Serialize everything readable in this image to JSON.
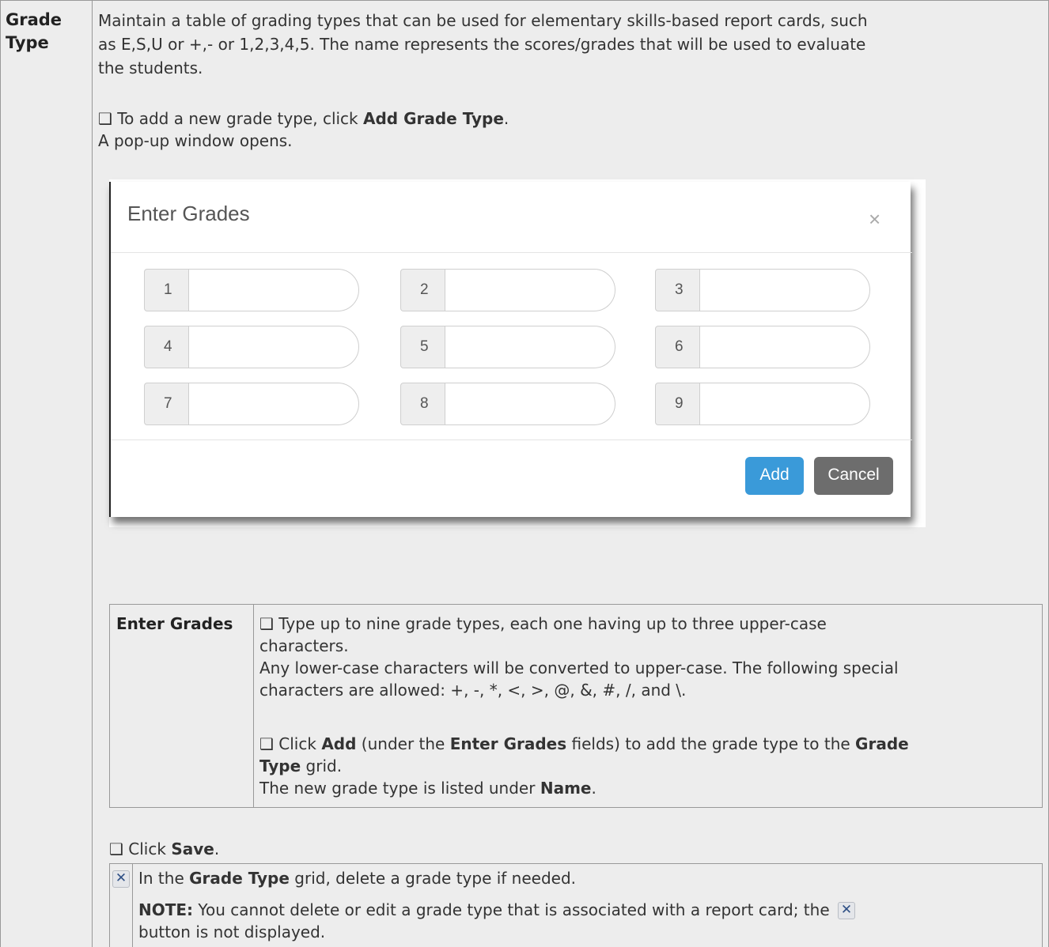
{
  "row_label": [
    "Grade",
    "Type"
  ],
  "intro": {
    "line1": "Maintain a table of grading types that can be used for elementary skills-based report cards, such",
    "line2": "as E,S,U or +,- or 1,2,3,4,5. The name represents the scores/grades that will be used to evaluate",
    "line3": "the students."
  },
  "step_add": {
    "checkbox": "❑",
    "pre": " To add a new grade type, click ",
    "bold": "Add Grade Type",
    "post": ".",
    "line2": "A pop-up window opens."
  },
  "modal": {
    "title": "Enter Grades",
    "close": "×",
    "fields": [
      "1",
      "2",
      "3",
      "4",
      "5",
      "6",
      "7",
      "8",
      "9"
    ],
    "add_button": "Add",
    "cancel_button": "Cancel"
  },
  "inner": {
    "label": "Enter Grades",
    "l1": "❑ Type up to nine grade types, each one having up to three upper-case",
    "l2": "characters.",
    "l3": "Any lower-case characters will be converted to upper-case. The following special",
    "l4": "characters are allowed: +, -, *, <, >, @, &, #, /, and \\.",
    "l5_a": "❑ Click ",
    "l5_b": "Add",
    "l5_c": " (under the ",
    "l5_d": "Enter Grades",
    "l5_e": " fields) to add the grade type to the ",
    "l5_f": "Grade",
    "l6_a": "Type",
    "l6_b": " grid.",
    "l7_a": "The new grade type is listed under ",
    "l7_b": "Name",
    "l7_c": "."
  },
  "save": {
    "a": "❑ Click ",
    "b": "Save",
    "c": "."
  },
  "note": {
    "icon": "✕",
    "l1_a": "In the ",
    "l1_b": "Grade Type",
    "l1_c": " grid, delete a grade type if needed.",
    "l2_a": "NOTE:",
    "l2_b": " You cannot delete or edit a grade type that is associated with a report card; the ",
    "l3": "button is not displayed."
  }
}
